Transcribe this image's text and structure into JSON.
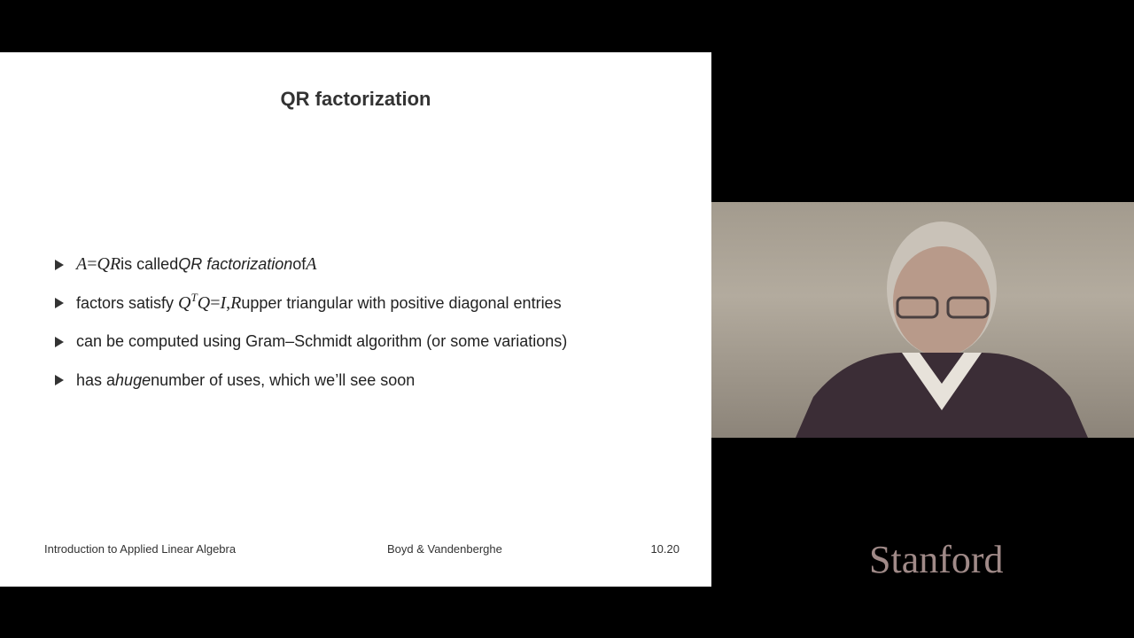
{
  "slide": {
    "title": "QR factorization",
    "bullets": [
      {
        "parts": [
          "A",
          " = ",
          "QR",
          " is called ",
          "QR factorization",
          " of ",
          "A"
        ]
      },
      {
        "parts": [
          "factors satisfy ",
          "Q",
          "T",
          "Q",
          " = ",
          "I",
          ", ",
          "R",
          " upper triangular with positive diagonal entries"
        ]
      },
      {
        "text": "can be computed using Gram–Schmidt algorithm (or some variations)"
      },
      {
        "parts": [
          "has a ",
          "huge",
          " number of uses, which we’ll see soon"
        ]
      }
    ],
    "footer": {
      "left": "Introduction to Applied Linear Algebra",
      "center": "Boyd & Vandenberghe",
      "right": "10.20"
    }
  },
  "webcam": {
    "subject": "presenter-video"
  },
  "branding": {
    "logo_text": "Stanford",
    "logo_color": "#a08a88"
  }
}
